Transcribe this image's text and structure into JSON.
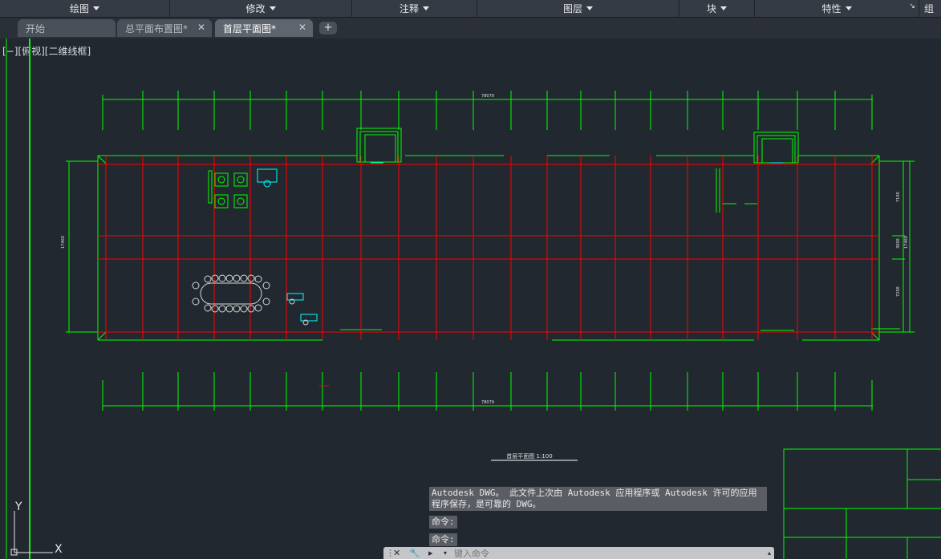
{
  "ribbon": {
    "panels": [
      {
        "label": "绘图"
      },
      {
        "label": "修改"
      },
      {
        "label": "注释"
      },
      {
        "label": "图层"
      },
      {
        "label": "块"
      },
      {
        "label": "特性"
      },
      {
        "label": "组"
      }
    ]
  },
  "tabs": [
    {
      "label": "开始"
    },
    {
      "label": "总平面布置图*"
    },
    {
      "label": "首层平面图*"
    }
  ],
  "viewport": {
    "label": "[−][俯视][二维线框]"
  },
  "drawing": {
    "dim_top": "78079",
    "dim_bottom": "78079",
    "dim_left": "17400",
    "dim_right_1": "7100",
    "dim_right_2": "3000",
    "dim_right_3": "7200",
    "dim_right_total": "17400",
    "title": "首层平面图 1:100"
  },
  "ucs": {
    "x_label": "X",
    "y_label": "Y"
  },
  "command": {
    "history": [
      "Autodesk DWG。  此文件上次由 Autodesk 应用程序或 Autodesk 许可的应用程序保存，是可靠的 DWG。",
      "命令:",
      "命令:"
    ],
    "placeholder": "键入命令"
  },
  "colors": {
    "wall": "#00ff00",
    "grid": "#ff0000",
    "furniture": "#00ffff",
    "background": "#212830"
  }
}
